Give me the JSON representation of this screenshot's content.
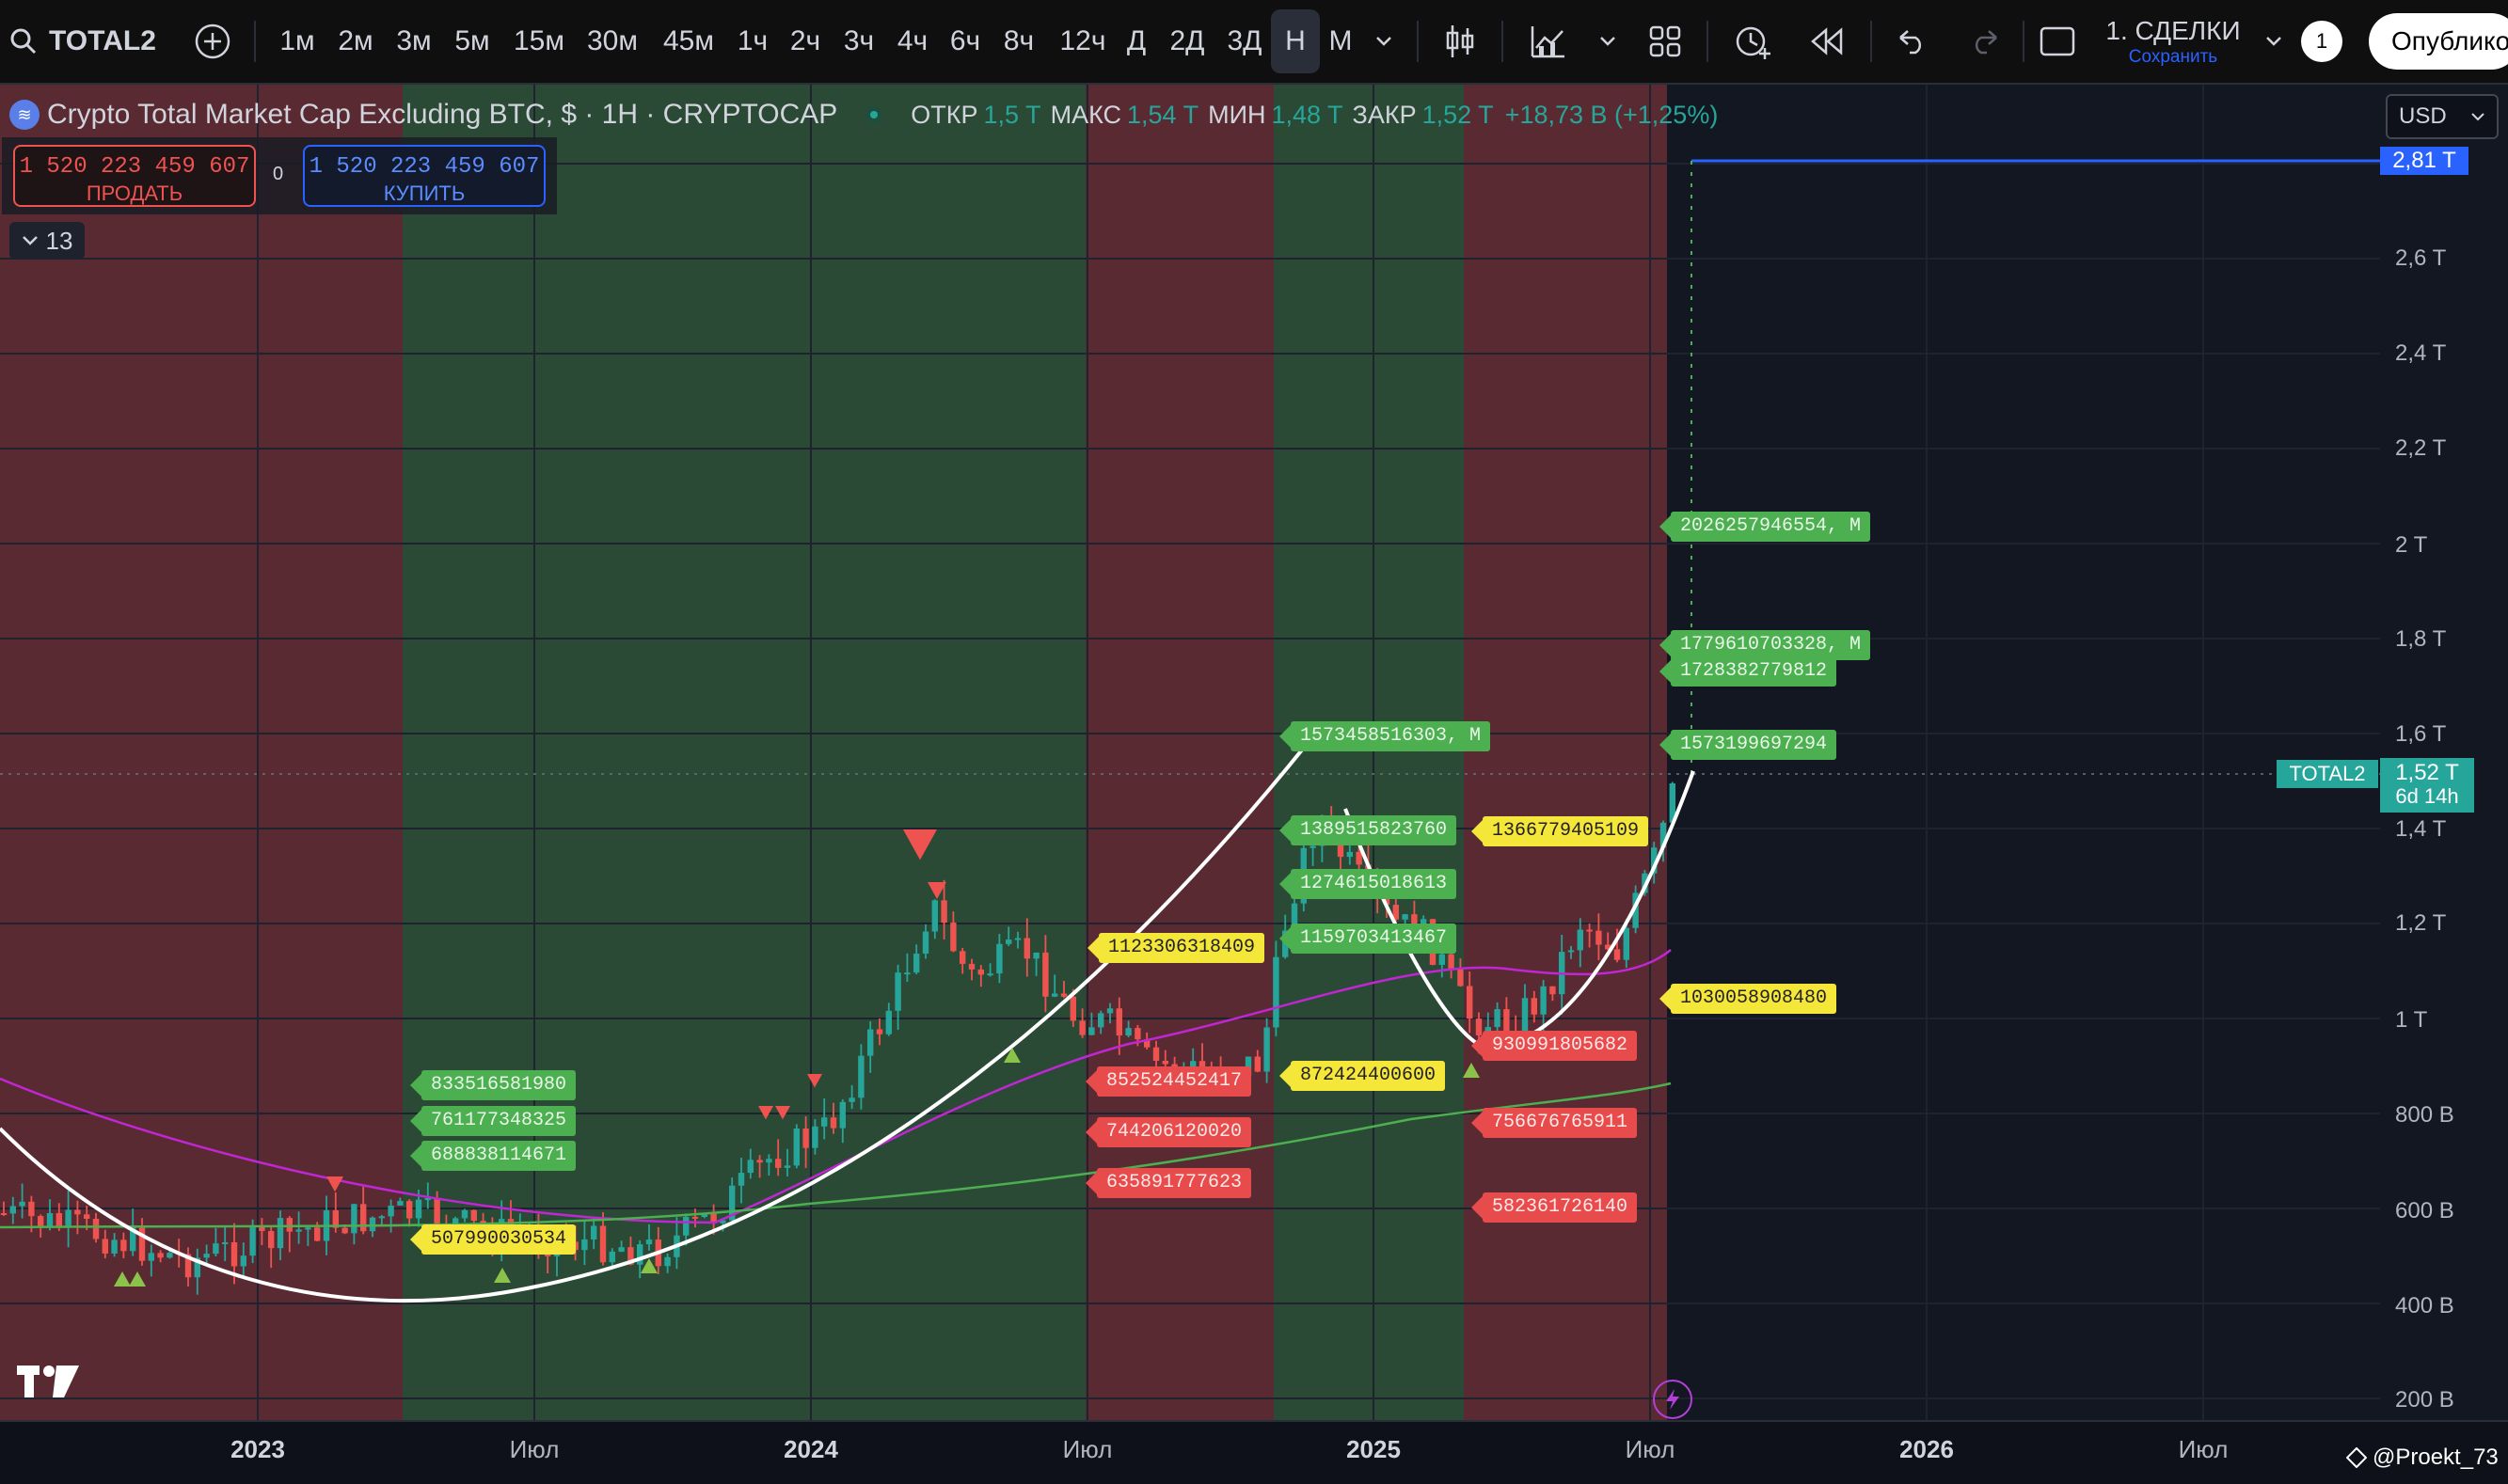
{
  "toolbar": {
    "symbol": "TOTAL2",
    "intervals": [
      "1м",
      "2м",
      "3м",
      "5м",
      "15м",
      "30м",
      "45м",
      "1ч",
      "2ч",
      "3ч",
      "4ч",
      "6ч",
      "8ч",
      "12ч",
      "Д",
      "2Д",
      "3Д",
      "Н",
      "М"
    ],
    "active_interval": "Н",
    "layout_name": "1. СДЕЛКИ",
    "save_label": "Сохранить",
    "badge": "1",
    "publish_label": "Опублико"
  },
  "legend": {
    "title": "Crypto Total Market Cap Excluding BTC, $ · 1Н · CRYPTOCAP",
    "open_label": "ОТКР",
    "open_value": "1,5 T",
    "high_label": "МАКС",
    "high_value": "1,54 T",
    "low_label": "МИН",
    "low_value": "1,48 T",
    "close_label": "ЗАКР",
    "close_value": "1,52 T",
    "change": "+18,73 B (+1,25%)"
  },
  "trade": {
    "sell_price": "1 520 223 459 607",
    "sell_label": "ПРОДАТЬ",
    "spread": "0",
    "buy_price": "1 520 223 459 607",
    "buy_label": "КУПИТЬ"
  },
  "indicators_toggle": "13",
  "currency": "USD",
  "price_axis": {
    "labels": [
      "2,6 T",
      "2,4 T",
      "2,2 T",
      "2 T",
      "1,8 T",
      "1,6 T",
      "1,4 T",
      "1,2 T",
      "1 T",
      "800 B",
      "600 B",
      "400 B",
      "200 B"
    ],
    "blue_line_label": "2,81 T",
    "current_symbol": "TOTAL2",
    "current_price": "1,52 T",
    "countdown": "6d 14h"
  },
  "time_axis": [
    {
      "label": "2023",
      "year": true
    },
    {
      "label": "Июл",
      "year": false
    },
    {
      "label": "2024",
      "year": true
    },
    {
      "label": "Июл",
      "year": false
    },
    {
      "label": "2025",
      "year": true
    },
    {
      "label": "Июл",
      "year": false
    },
    {
      "label": "2026",
      "year": true
    },
    {
      "label": "Июл",
      "year": false
    }
  ],
  "annotations": [
    {
      "text": "833516581980",
      "type": "g"
    },
    {
      "text": "761177348325",
      "type": "g"
    },
    {
      "text": "688838114671",
      "type": "g"
    },
    {
      "text": "507990030534",
      "type": "y"
    },
    {
      "text": "1123306318409",
      "type": "y"
    },
    {
      "text": "852524452417",
      "type": "r"
    },
    {
      "text": "744206120020",
      "type": "r"
    },
    {
      "text": "635891777623",
      "type": "r"
    },
    {
      "text": "1573458516303, M",
      "type": "g"
    },
    {
      "text": "1389515823760",
      "type": "g"
    },
    {
      "text": "1274615018613",
      "type": "g"
    },
    {
      "text": "1159703413467",
      "type": "g"
    },
    {
      "text": "872424400600",
      "type": "y"
    },
    {
      "text": "1366779405109",
      "type": "y"
    },
    {
      "text": "930991805682",
      "type": "r"
    },
    {
      "text": "756676765911",
      "type": "r"
    },
    {
      "text": "582361726140",
      "type": "r"
    },
    {
      "text": "2026257946554, M",
      "type": "g"
    },
    {
      "text": "1779610703328, M",
      "type": "g"
    },
    {
      "text": "1728382779812",
      "type": "g"
    },
    {
      "text": "1573199697294",
      "type": "g"
    },
    {
      "text": "1030058908480",
      "type": "y"
    }
  ],
  "watermark": "@Proekt_73",
  "colors": {
    "bull": "#26a69a",
    "bear": "#ef5350",
    "blue": "#2962ff",
    "zone_red": "#5a2a32",
    "zone_green": "#2b4a35"
  }
}
